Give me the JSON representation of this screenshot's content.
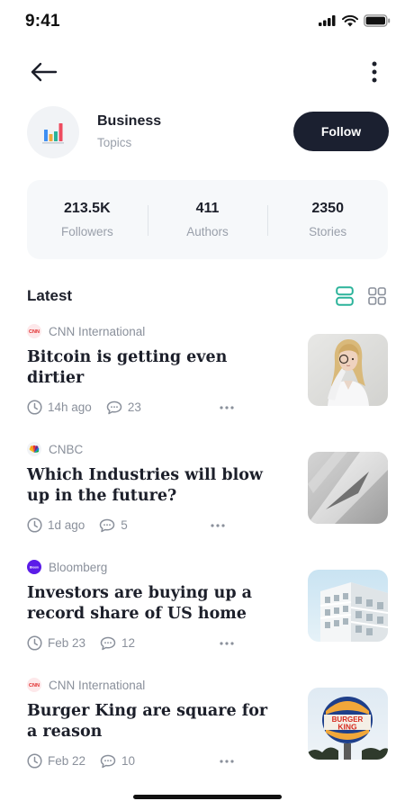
{
  "status_bar": {
    "time": "9:41"
  },
  "icons": {
    "back": "arrow-left-icon",
    "more": "more-vertical-icon",
    "topic": "bar-chart-icon",
    "list_view": "list-view-icon",
    "grid_view": "grid-view-icon",
    "clock": "clock-icon",
    "comment": "comment-icon",
    "dots": "more-horizontal-icon"
  },
  "topic": {
    "title": "Business",
    "subtitle": "Topics",
    "follow_label": "Follow"
  },
  "stats": [
    {
      "value": "213.5K",
      "label": "Followers"
    },
    {
      "value": "411",
      "label": "Authors"
    },
    {
      "value": "2350",
      "label": "Stories"
    }
  ],
  "section": {
    "title": "Latest"
  },
  "articles": [
    {
      "source": "CNN International",
      "headline": "Bitcoin is getting even dirtier",
      "time": "14h ago",
      "comments": "23"
    },
    {
      "source": "CNBC",
      "headline": "Which Industries will blow up in the future?",
      "time": "1d ago",
      "comments": "5"
    },
    {
      "source": "Bloomberg",
      "headline": "Investors are buying up a record share of US home",
      "time": "Feb 23",
      "comments": "12"
    },
    {
      "source": "CNN International",
      "headline": "Burger King are square for a reason",
      "time": "Feb 22",
      "comments": "10"
    }
  ],
  "colors": {
    "accent": "#2bb39a",
    "follow_button": "#1b2030",
    "muted_text": "#9aa0ab",
    "card_background": "#f6f8fa"
  }
}
